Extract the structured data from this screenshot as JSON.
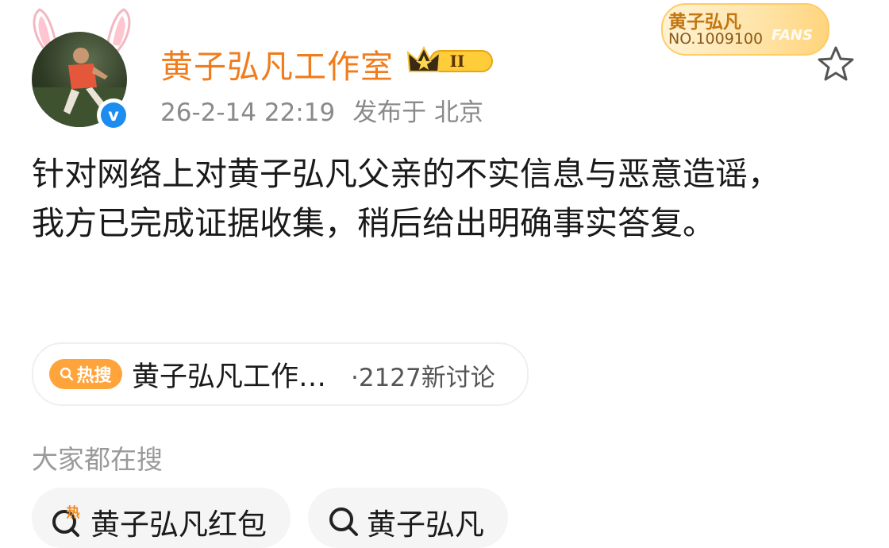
{
  "post": {
    "author": "黄子弘凡工作室",
    "badge_level": "II",
    "timestamp": "26-2-14 22:19",
    "location": "发布于 北京",
    "content": "针对网络上对黄子弘凡父亲的不实信息与恶意造谣，我方已完成证据收集，稍后给出明确事实答复。"
  },
  "fans_card": {
    "name": "黄子弘凡",
    "number": "NO.1009100",
    "label": "FANS"
  },
  "hot_topic": {
    "tag": "热搜",
    "text": "黄子弘凡工作…",
    "count": "·2127新讨论"
  },
  "related": {
    "title": "大家都在搜",
    "items": [
      {
        "label": "黄子弘凡红包",
        "hot": true,
        "hot_mark": "热"
      },
      {
        "label": "黄子弘凡",
        "hot": false
      }
    ]
  },
  "colors": {
    "username": "#f07c1c",
    "hot_tag": "#ffa43a",
    "verified": "#1d8cf0",
    "meta": "#8a8a8a"
  },
  "icons": [
    "bunny-ears-icon",
    "verified-icon",
    "crown-badge-icon",
    "star-icon",
    "search-icon"
  ]
}
